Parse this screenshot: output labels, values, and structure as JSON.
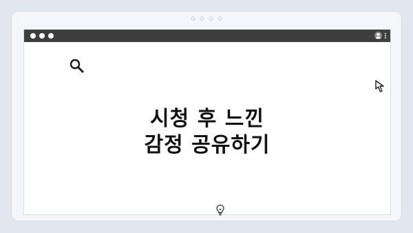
{
  "hero": {
    "title_line_1": "시청 후 느낀",
    "title_line_2": "감정 공유하기"
  },
  "icons": {
    "top_left": "search-icon",
    "top_right": "cursor-icon",
    "bottom": "lightbulb-icon",
    "titlebar_right": [
      "profile-icon",
      "more-vert-icon"
    ]
  },
  "colors": {
    "page_background": "#e2e6ee",
    "titlebar": "#3e3e3e",
    "window": "#ffffff",
    "title_text": "#111111"
  }
}
